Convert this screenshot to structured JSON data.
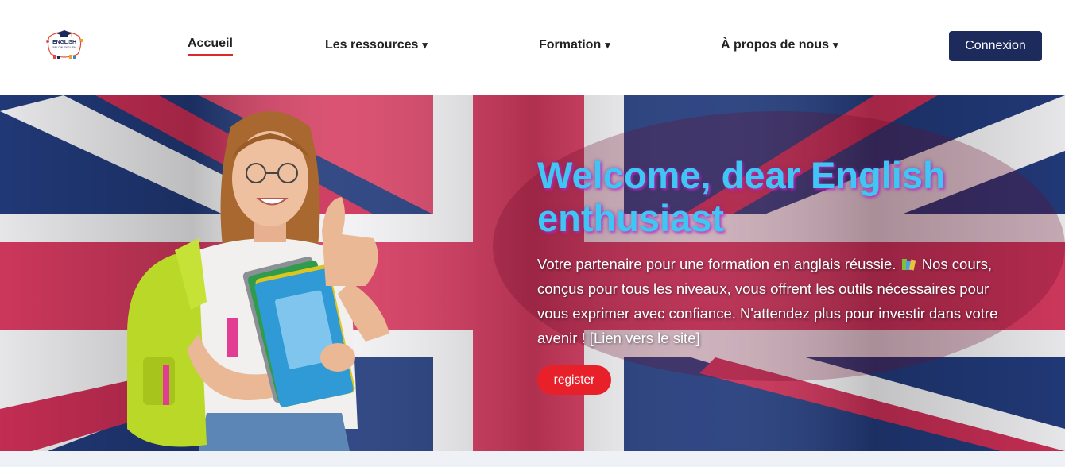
{
  "header": {
    "logo": {
      "text": "ENGLISH",
      "subtext": "BELOW ENGLISH",
      "icon": "graduation-cap-icon"
    },
    "nav": [
      {
        "label": "Accueil",
        "active": true,
        "has_dropdown": false
      },
      {
        "label": "Les ressources",
        "active": false,
        "has_dropdown": true
      },
      {
        "label": "Formation",
        "active": false,
        "has_dropdown": true
      },
      {
        "label": "À propos de nous",
        "active": false,
        "has_dropdown": true
      }
    ],
    "dropdown_caret": "▾",
    "login_label": "Connexion"
  },
  "hero": {
    "title": "Welcome, dear English enthusiast",
    "body_before_icon": "Votre partenaire pour une formation en anglais réussie.",
    "icon": "books-icon",
    "body_after_icon": "Nos cours, conçus pour tous les niveaux, vous offrent les outils nécessaires pour vous exprimer avec confiance. N'attendez plus pour investir dans votre avenir ! [Lien vers le site]",
    "register_label": "register",
    "background": "uk-flag",
    "illustration": "student-with-backpack-and-books"
  },
  "colors": {
    "nav_text": "#222222",
    "active_underline": "#d92b2b",
    "login_bg": "#1c2a5c",
    "title": "#3fc6f2",
    "title_glow": "#be28c8",
    "register_bg": "#e8202a",
    "flag_red": "#d84467",
    "flag_blue": "#1f3a7a"
  }
}
